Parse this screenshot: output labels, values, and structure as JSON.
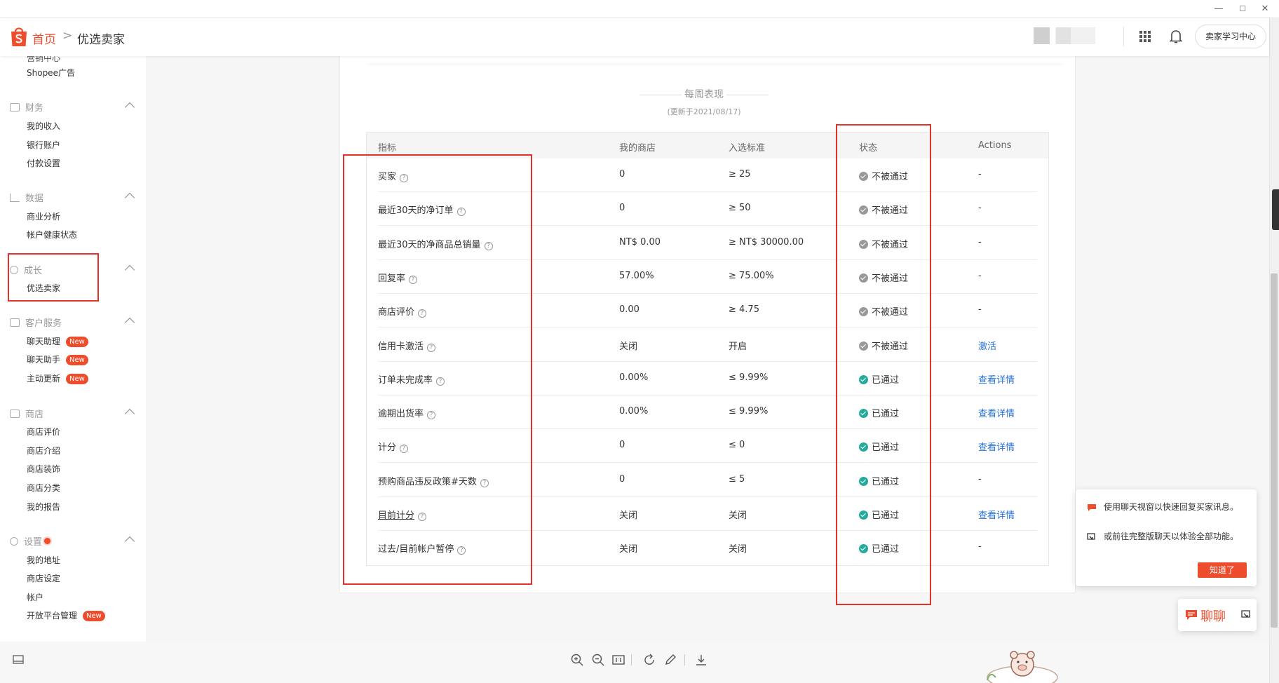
{
  "breadcrumb": {
    "home": "首页",
    "separator": ">",
    "current": "优选卖家"
  },
  "header": {
    "learning_center": "卖家学习中心"
  },
  "sidebar": {
    "partial_top": "营销中心",
    "items_top": [
      "Shopee广告"
    ],
    "sections": [
      {
        "title": "财务",
        "items": [
          "我的收入",
          "银行账户",
          "付款设置"
        ]
      },
      {
        "title": "数据",
        "items": [
          "商业分析",
          "帐户健康状态"
        ]
      },
      {
        "title": "成长",
        "items": [
          "优选卖家"
        ]
      },
      {
        "title": "客户服务",
        "items": [
          "聊天助理",
          "聊天助手",
          "主动更新"
        ],
        "badge": "New"
      },
      {
        "title": "商店",
        "items": [
          "商店评价",
          "商店介绍",
          "商店装饰",
          "商店分类",
          "我的报告"
        ]
      },
      {
        "title": "设置",
        "items": [
          "我的地址",
          "商店设定",
          "帐户",
          "开放平台管理"
        ],
        "badge": "New"
      }
    ]
  },
  "weekly": {
    "title": "每周表现",
    "updated": "(更新于2021/08/17)"
  },
  "table": {
    "headers": [
      "指标",
      "我的商店",
      "入选标准",
      "状态",
      "Actions"
    ],
    "rows": [
      {
        "metric": "买家",
        "mine": "0",
        "standard": "≥ 25",
        "status": "不被通过",
        "action": "-"
      },
      {
        "metric": "最近30天的净订单",
        "mine": "0",
        "standard": "≥ 50",
        "status": "不被通过",
        "action": "-"
      },
      {
        "metric": "最近30天的净商品总销量",
        "mine": "NT$ 0.00",
        "standard": "≥ NT$ 30000.00",
        "status": "不被通过",
        "action": "-"
      },
      {
        "metric": "回复率",
        "mine": "57.00%",
        "standard": "≥ 75.00%",
        "status": "不被通过",
        "action": "-"
      },
      {
        "metric": "商店评价",
        "mine": "0.00",
        "standard": "≥ 4.75",
        "status": "不被通过",
        "action": "-"
      },
      {
        "metric": "信用卡激活",
        "mine": "关闭",
        "standard": "开启",
        "status": "不被通过",
        "action": "激活"
      },
      {
        "metric": "订单未完成率",
        "mine": "0.00%",
        "standard": "≤ 9.99%",
        "status": "已通过",
        "action": "查看详情"
      },
      {
        "metric": "逾期出货率",
        "mine": "0.00%",
        "standard": "≤ 9.99%",
        "status": "已通过",
        "action": "查看详情"
      },
      {
        "metric": "计分",
        "mine": "0",
        "standard": "≤ 0",
        "status": "已通过",
        "action": "查看详情"
      },
      {
        "metric": "预购商品违反政策#天数",
        "mine": "0",
        "standard": "≤ 5",
        "status": "已通过",
        "action": "-"
      },
      {
        "metric": "目前计分",
        "mine": "关闭",
        "standard": "关闭",
        "status": "已通过",
        "action": "查看详情"
      },
      {
        "metric": "过去/目前帐户暂停",
        "mine": "关闭",
        "standard": "关闭",
        "status": "已通过",
        "action": "-"
      }
    ]
  },
  "chat_tip": {
    "line1": "使用聊天视窗以快速回复买家讯息。",
    "line2": "或前往完整版聊天以体验全部功能。",
    "button": "知道了"
  },
  "chat_button": "聊聊",
  "window_controls": {
    "minimize": "—",
    "maximize": "☐",
    "close": "✕"
  },
  "colors": {
    "brand": "#ee4d2d",
    "pass": "#26aa99",
    "fail": "#999999",
    "link": "#2673dd",
    "annotation": "#e0332a"
  }
}
